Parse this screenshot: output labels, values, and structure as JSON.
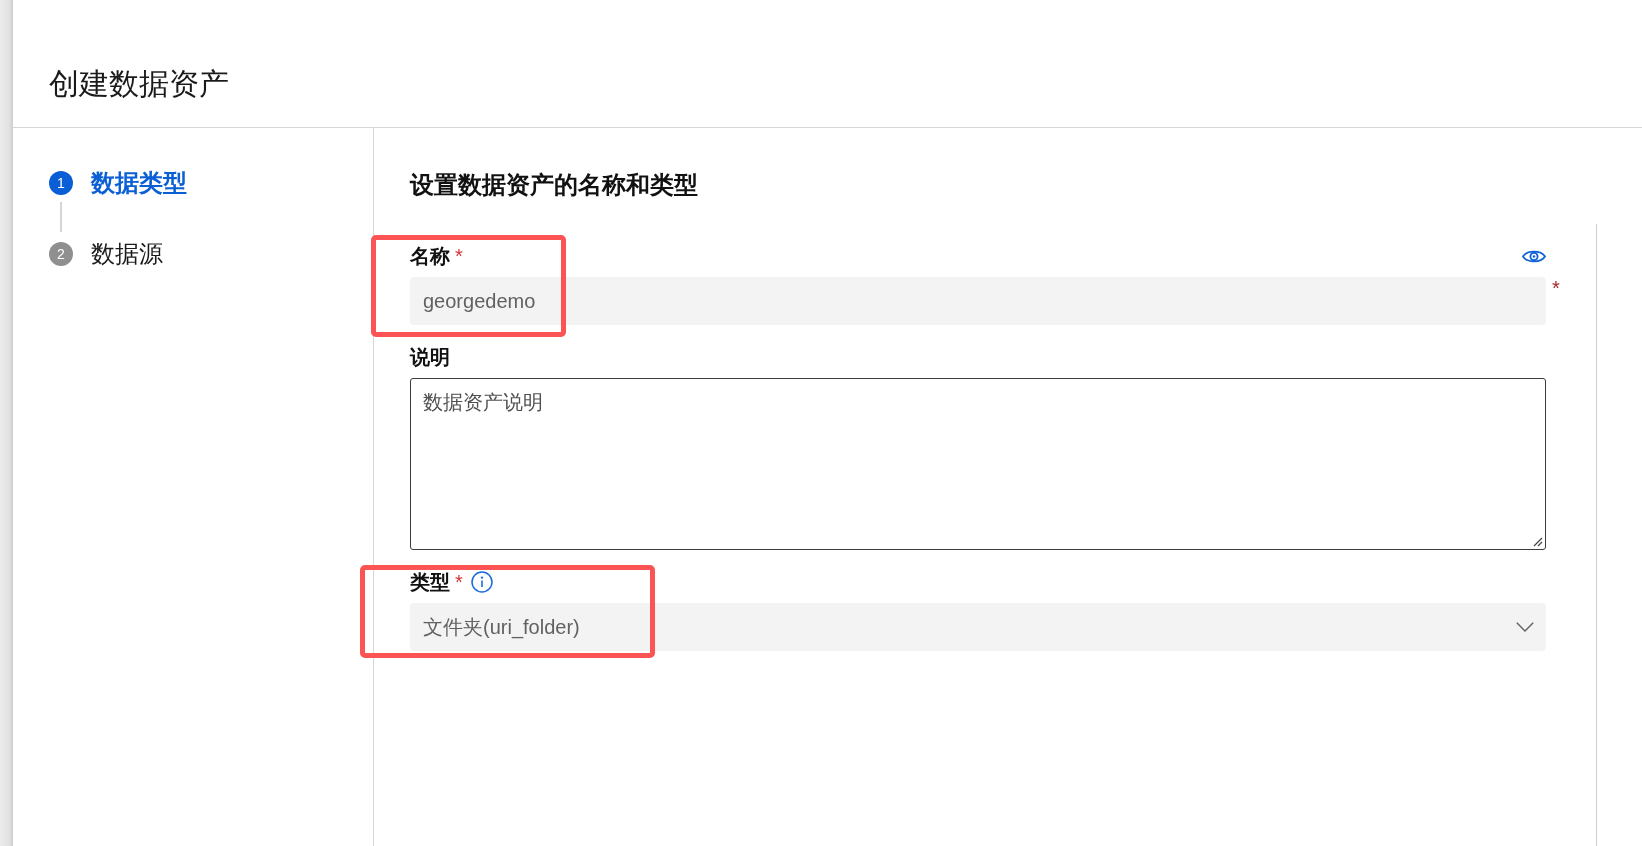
{
  "panel": {
    "title": "创建数据资产"
  },
  "steps": [
    {
      "number": "1",
      "label": "数据类型",
      "selected": true
    },
    {
      "number": "2",
      "label": "数据源",
      "selected": false
    }
  ],
  "form": {
    "heading": "设置数据资产的名称和类型",
    "fields": [
      {
        "kind": "text",
        "label": "名称",
        "required_mark": "*",
        "visibility_toggle": true,
        "value": "georgedemo",
        "trailing_mark": "*",
        "highlighted": true
      },
      {
        "kind": "textarea",
        "label": "说明",
        "placeholder": "数据资产说明",
        "highlighted": false
      },
      {
        "kind": "select",
        "label": "类型",
        "required_mark": "*",
        "info_icon": true,
        "value": "文件夹(uri_folder)",
        "highlighted": true
      }
    ]
  }
}
